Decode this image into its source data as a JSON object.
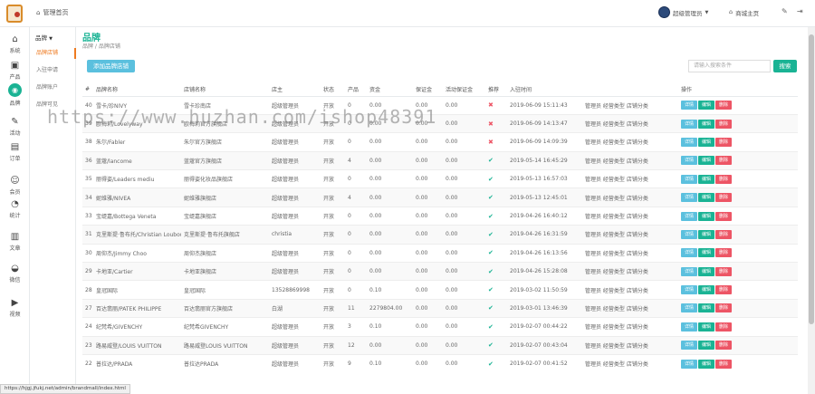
{
  "header": {
    "home_label": "管理首页",
    "user_name": "超级管理员",
    "store_home": "商城主页"
  },
  "rail": [
    {
      "name": "rail-item-system",
      "label": "系统",
      "icon": "home-icon",
      "glyph": "⌂"
    },
    {
      "name": "rail-item-products",
      "label": "产品",
      "icon": "picture-icon",
      "glyph": "▣"
    },
    {
      "name": "rail-item-brand",
      "label": "品牌",
      "icon": "brand-icon",
      "glyph": "◉"
    },
    {
      "name": "rail-item-activity",
      "label": "活动",
      "icon": "pen-icon",
      "glyph": "✎"
    },
    {
      "name": "rail-item-orders",
      "label": "订单",
      "icon": "cart-icon",
      "glyph": "▤"
    },
    {
      "name": "rail-item-members",
      "label": "会员",
      "icon": "user-icon",
      "glyph": "☺"
    },
    {
      "name": "rail-item-stats",
      "label": "统计",
      "icon": "stats-icon",
      "glyph": "◔"
    },
    {
      "name": "rail-item-articles",
      "label": "文章",
      "icon": "document-icon",
      "glyph": "▥"
    },
    {
      "name": "rail-item-wechat",
      "label": "微信",
      "icon": "wechat-icon",
      "glyph": "◒"
    },
    {
      "name": "rail-item-video",
      "label": "视频",
      "icon": "video-icon",
      "glyph": "▶"
    }
  ],
  "subnav": {
    "head": "品牌",
    "items": [
      "品牌店铺",
      "入驻申请",
      "品牌账户",
      "品牌可见"
    ]
  },
  "page": {
    "title": "品牌",
    "crumbs": "品牌 / 品牌店铺",
    "add_label": "添加品牌店铺",
    "search_placeholder": "请输入搜索条件",
    "search_label": "搜索"
  },
  "table": {
    "headers": [
      "#",
      "品牌名称",
      "店铺名称",
      "店主",
      "状态",
      "产品",
      "资金",
      "保证金",
      "活动保证金",
      "推荐",
      "入驻时间",
      "",
      "操作"
    ],
    "rows": [
      [
        "40",
        "雪卡/珍NIVY",
        "雪卡珍南店",
        "超级管理员",
        "开放",
        "0",
        "0.00",
        "0.00",
        "0.00",
        "no",
        "2019-06-09 15:11:43",
        "管理员 经营类型 店铺分类"
      ],
      [
        "39",
        "欧梅莉/Lovelyway",
        "欧梅莉官方旗舰店",
        "超级管理员",
        "开放",
        "0",
        "0.00",
        "0.00",
        "0.00",
        "no",
        "2019-06-09 14:13:47",
        "管理员 经营类型 店铺分类"
      ],
      [
        "38",
        "朱尔/Fabler",
        "朱尔官方旗舰店",
        "超级管理员",
        "开放",
        "0",
        "0.00",
        "0.00",
        "0.00",
        "no",
        "2019-06-09 14:09:39",
        "管理员 经营类型 店铺分类"
      ],
      [
        "36",
        "蓝蔻/lancome",
        "蓝蔻官方旗舰店",
        "超级管理员",
        "开放",
        "4",
        "0.00",
        "0.00",
        "0.00",
        "yes",
        "2019-05-14 16:45:29",
        "管理员 经营类型 店铺分类"
      ],
      [
        "35",
        "丽得姿/Leaders mediu",
        "丽得姿化妆品旗舰店",
        "超级管理员",
        "开放",
        "0",
        "0.00",
        "0.00",
        "0.00",
        "yes",
        "2019-05-13 16:57:03",
        "管理员 经营类型 店铺分类"
      ],
      [
        "34",
        "妮维雅/NIVEA",
        "妮维雅旗舰店",
        "超级管理员",
        "开放",
        "4",
        "0.00",
        "0.00",
        "0.00",
        "yes",
        "2019-05-13 12:45:01",
        "管理员 经营类型 店铺分类"
      ],
      [
        "33",
        "宝缇嘉/Bottega Veneta",
        "宝缇嘉旗舰店",
        "超级管理员",
        "开放",
        "0",
        "0.00",
        "0.00",
        "0.00",
        "yes",
        "2019-04-26 16:40:12",
        "管理员 经营类型 店铺分类"
      ],
      [
        "31",
        "克里斯提·鲁布托/Christian Louboutin",
        "克里斯提·鲁布托旗舰店",
        "christia",
        "开放",
        "0",
        "0.00",
        "0.00",
        "0.00",
        "yes",
        "2019-04-26 16:31:59",
        "管理员 经营类型 店铺分类"
      ],
      [
        "30",
        "周仰杰/Jimmy Choo",
        "周仰杰旗舰店",
        "超级管理员",
        "开放",
        "0",
        "0.00",
        "0.00",
        "0.00",
        "yes",
        "2019-04-26 16:13:56",
        "管理员 经营类型 店铺分类"
      ],
      [
        "29",
        "卡地亚/Cartier",
        "卡地亚旗舰店",
        "超级管理员",
        "开放",
        "0",
        "0.00",
        "0.00",
        "0.00",
        "yes",
        "2019-04-26 15:28:08",
        "管理员 经营类型 店铺分类"
      ],
      [
        "28",
        "皇冠国际",
        "皇冠国际",
        "13528869998",
        "开放",
        "0",
        "0.10",
        "0.00",
        "0.00",
        "yes",
        "2019-03-02 11:50:59",
        "管理员 经营类型 店铺分类"
      ],
      [
        "27",
        "百达翡丽/PATEK PHILIPPE",
        "百达翡丽官方旗舰店",
        "白湖",
        "开放",
        "11",
        "2279804.00",
        "0.00",
        "0.00",
        "yes",
        "2019-03-01 13:46:39",
        "管理员 经营类型 店铺分类"
      ],
      [
        "24",
        "纪梵希/GIVENCHY",
        "纪梵希GIVENCHY",
        "超级管理员",
        "开放",
        "3",
        "0.10",
        "0.00",
        "0.00",
        "yes",
        "2019-02-07 00:44:22",
        "管理员 经营类型 店铺分类"
      ],
      [
        "23",
        "路易威登/LOUIS VUITTON",
        "路易威登LOUIS VUITTON",
        "超级管理员",
        "开放",
        "12",
        "0.00",
        "0.00",
        "0.00",
        "yes",
        "2019-02-07 00:43:04",
        "管理员 经营类型 店铺分类"
      ],
      [
        "22",
        "普拉达/PRADA",
        "普拉达PRADA",
        "超级管理员",
        "开放",
        "9",
        "0.10",
        "0.00",
        "0.00",
        "yes",
        "2019-02-07 00:41:52",
        "管理员 经营类型 店铺分类"
      ]
    ],
    "action_labels": {
      "detail": "详情",
      "edit": "编辑",
      "delete": "删除"
    }
  },
  "statusbar": {
    "url": "https://hjgj.jfukj.net/admin/brandmall/index.html"
  },
  "watermark": "https://www.huzhan.com/ishop48391"
}
